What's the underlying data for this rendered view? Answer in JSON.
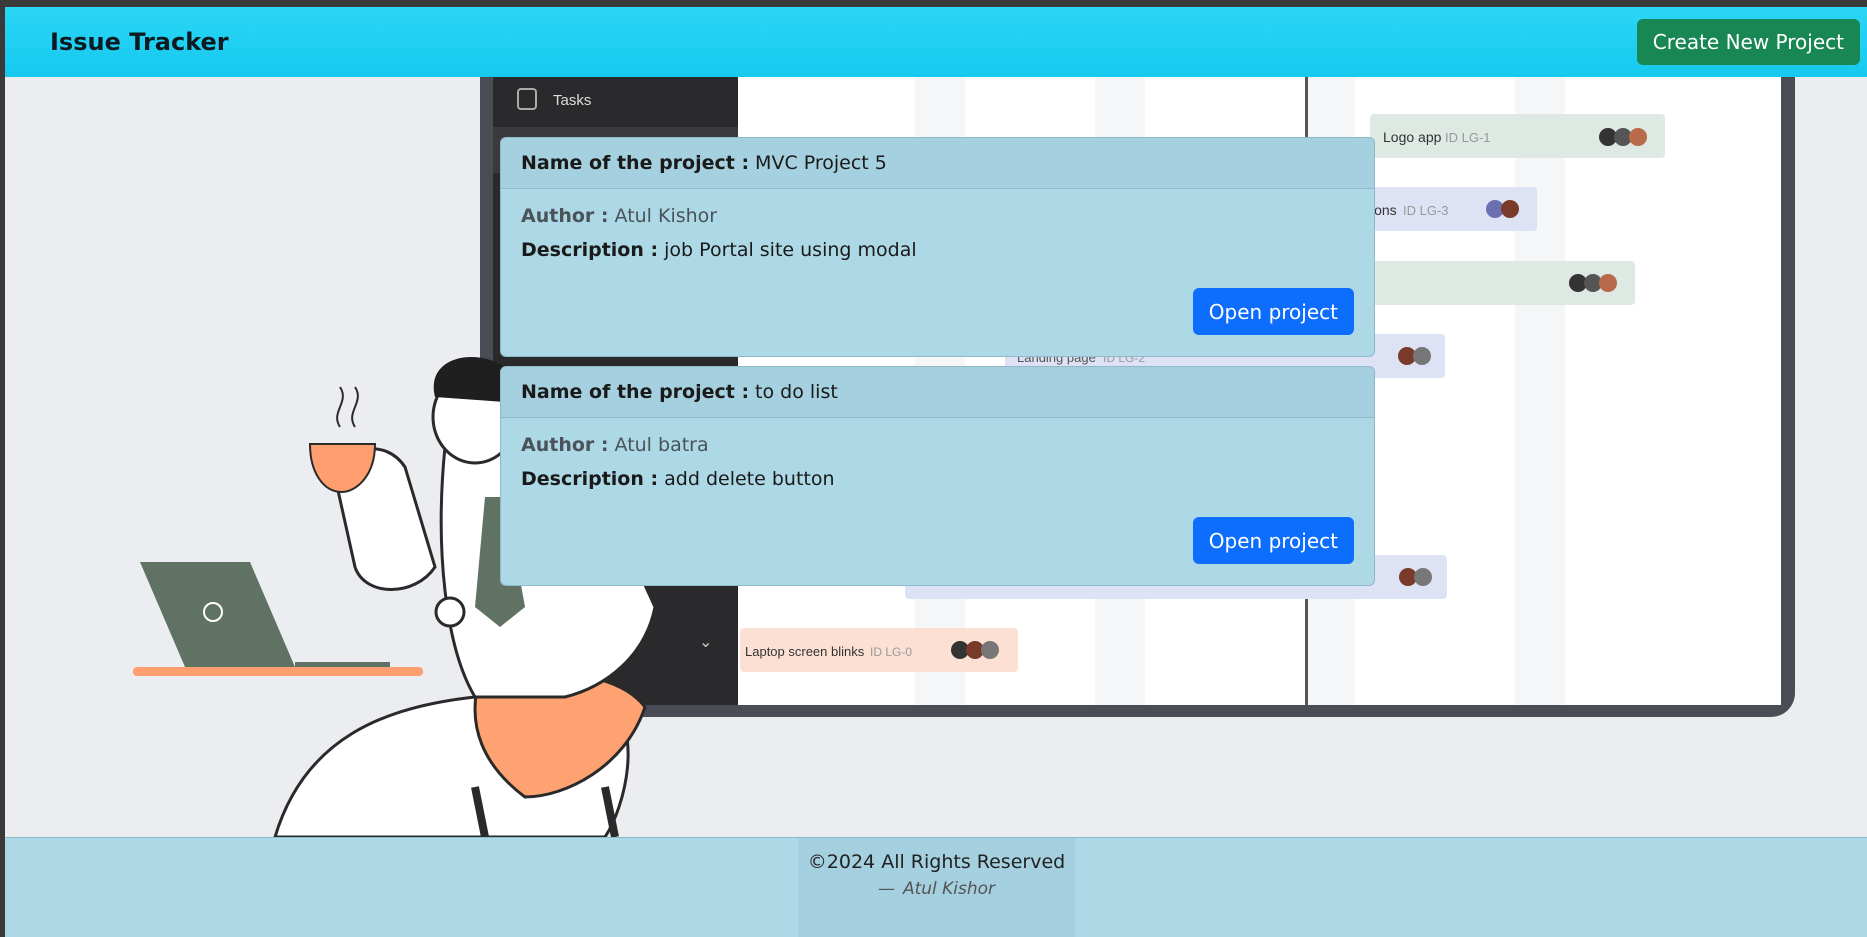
{
  "navbar": {
    "brand": "Issue Tracker",
    "create_button": "Create New Project"
  },
  "illustration": {
    "sidebar_item": "Tasks",
    "tasks": [
      {
        "name": "Logo app",
        "id": "ID LG-1"
      },
      {
        "name": "ions",
        "id": "ID LG-3"
      },
      {
        "name": "Landing page",
        "id": "ID LG-2"
      },
      {
        "name": "Laptop screen blinks",
        "id": "ID LG-0"
      }
    ]
  },
  "projects": [
    {
      "name_label": "Name of the project :",
      "name": "MVC Project 5",
      "author_label": "Author :",
      "author": "Atul Kishor",
      "description_label": "Description :",
      "description": "job Portal site using modal",
      "open_button": "Open project"
    },
    {
      "name_label": "Name of the project :",
      "name": "to do list",
      "author_label": "Author :",
      "author": "Atul batra",
      "description_label": "Description :",
      "description": "add delete button",
      "open_button": "Open project"
    }
  ],
  "footer": {
    "copyright": "©2024 All Rights Reserved",
    "dash": "—",
    "author": "Atul Kishor"
  }
}
